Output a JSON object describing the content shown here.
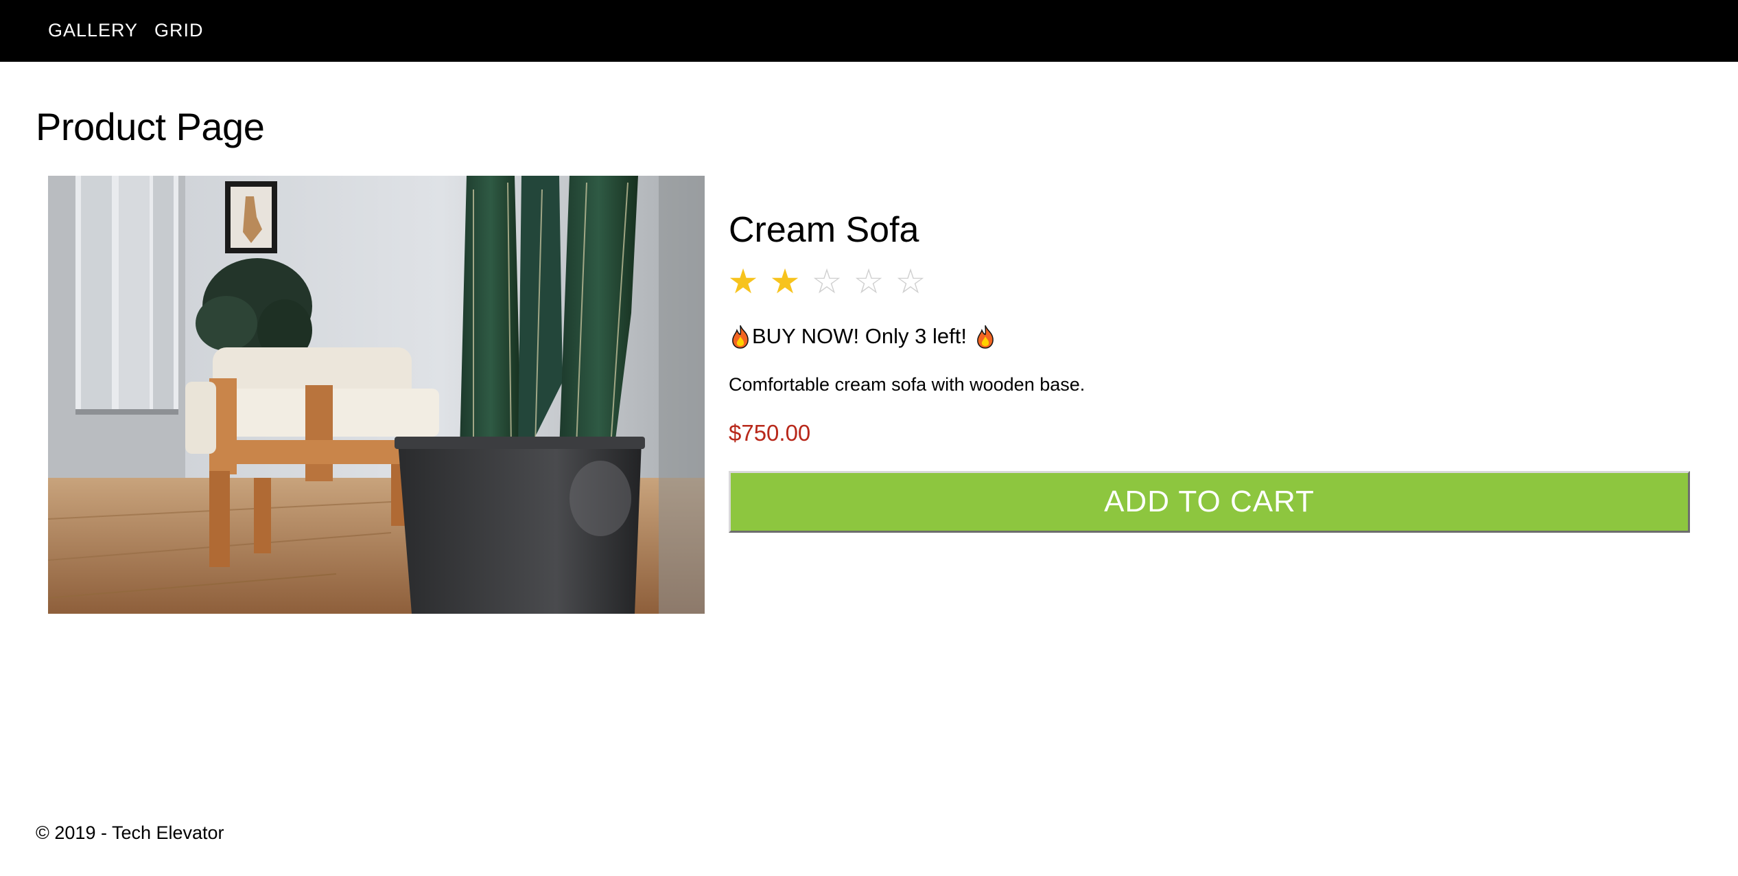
{
  "nav": {
    "items": [
      {
        "label": "GALLERY"
      },
      {
        "label": "GRID"
      }
    ]
  },
  "page": {
    "title": "Product Page"
  },
  "product": {
    "name": "Cream Sofa",
    "rating": {
      "value": 2,
      "max": 5,
      "filled_symbol": "★",
      "empty_symbol": "☆"
    },
    "urgency_text": "BUY NOW! Only 3 left!",
    "description": "Comfortable cream sofa with wooden base.",
    "price": "$750.00",
    "image_icon": "product-photo"
  },
  "cart": {
    "add_label": "ADD TO CART"
  },
  "footer": {
    "text": "© 2019 - Tech Elevator"
  },
  "colors": {
    "nav_bg": "#000000",
    "price": "#b8281a",
    "button_bg": "#8dc63f",
    "star_filled": "#f7c31d",
    "star_empty": "#cfcfcf"
  }
}
